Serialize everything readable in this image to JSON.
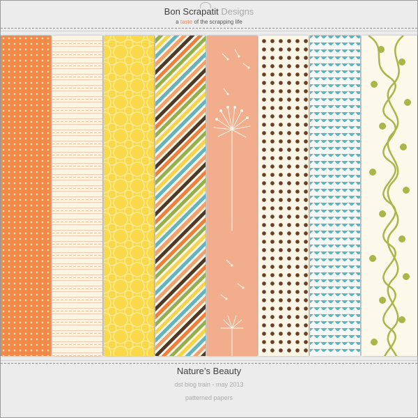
{
  "brand": {
    "part1": "Bon Scrapatit",
    "part2": "Designs"
  },
  "tagline": {
    "prefix": "a",
    "accent": "taste",
    "suffix": "of the scrapping life"
  },
  "papers": [
    {
      "name": "orange-polka-dot",
      "color": "#f18a46"
    },
    {
      "name": "cream-lined",
      "color": "#fbf5e4"
    },
    {
      "name": "yellow-quatrefoil",
      "color": "#f9d84a"
    },
    {
      "name": "diagonal-stripes",
      "color": "#fdf6e6"
    },
    {
      "name": "peach-dandelion",
      "color": "#f2ae8c"
    },
    {
      "name": "brown-polka-dot",
      "color": "#fcf6e7"
    },
    {
      "name": "teal-chevron",
      "color": "#59b8bf"
    },
    {
      "name": "green-vine",
      "color": "#fdf9ea"
    }
  ],
  "footer": {
    "title": "Nature’s Beauty",
    "subtitle": "dst blog train - may 2013",
    "caption": "patterned papers"
  }
}
